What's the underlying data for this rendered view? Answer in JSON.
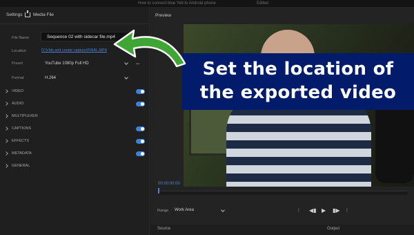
{
  "window": {
    "title": "How to connect blue Yeti to Android phone",
    "edited": "Edited"
  },
  "settings": {
    "title": "Settings",
    "media_file": "Media File",
    "file_name_label": "File Name",
    "file_name_value": "Sequence 02 with sidecar file.mp4",
    "location_label": "Location",
    "location_value": "D:\\Vids and create capture\\FINAL.MP4",
    "preset_label": "Preset",
    "preset_value": "YouTube 1080p Full HD",
    "format_label": "Format",
    "format_value": "H.264",
    "sections": [
      {
        "label": "VIDEO",
        "toggle": true
      },
      {
        "label": "AUDIO",
        "toggle": true
      },
      {
        "label": "MULTIPLEXER",
        "toggle": false
      },
      {
        "label": "CAPTIONS",
        "toggle": true
      },
      {
        "label": "EFFECTS",
        "toggle": true
      },
      {
        "label": "METADATA",
        "toggle": true
      },
      {
        "label": "GENERAL",
        "toggle": false
      }
    ]
  },
  "preview": {
    "title": "Preview",
    "headline_line1": "Set the location of",
    "headline_line2": "the exported video",
    "timecode": "00:00:00:00",
    "range_label": "Range",
    "range_value": "Work Area",
    "source_label": "Source",
    "output_label": "Output"
  },
  "colors": {
    "accent": "#3b82e0",
    "link": "#4a84d8",
    "headline_bg": "#021b6b",
    "arrow": "#3fa535"
  }
}
